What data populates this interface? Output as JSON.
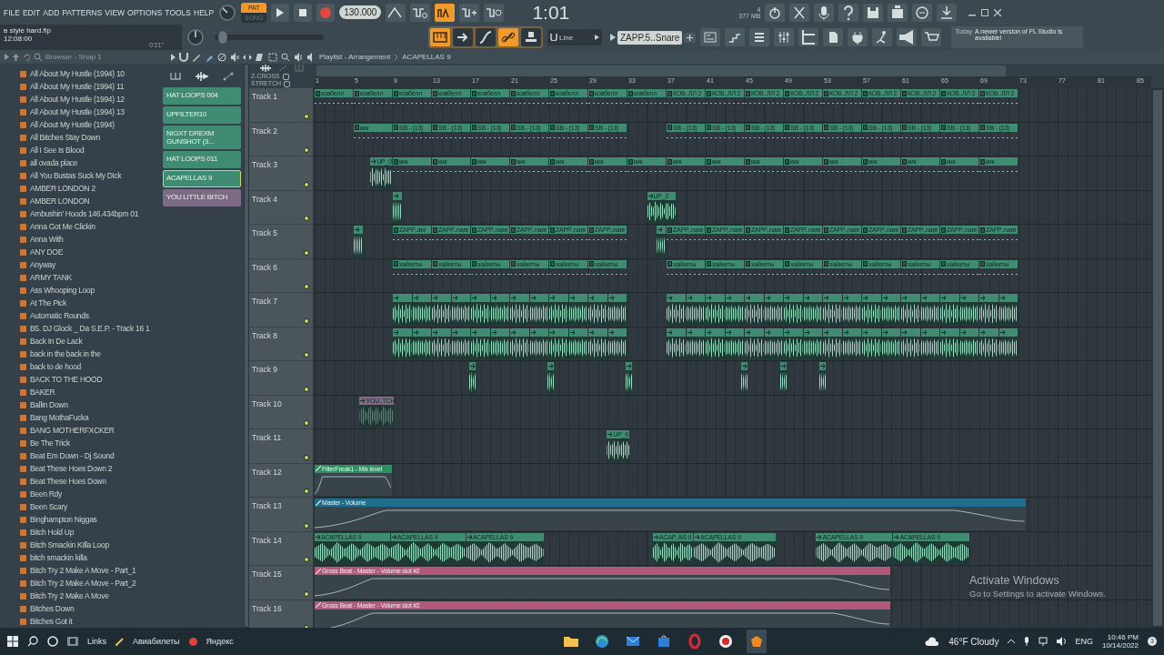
{
  "menu": [
    "FILE",
    "EDIT",
    "ADD",
    "PATTERNS",
    "VIEW",
    "OPTIONS",
    "TOOLS",
    "HELP"
  ],
  "project": {
    "file": "в style hard.flp",
    "time": "12:08:00",
    "duration": "0'21''"
  },
  "transport": {
    "modes": [
      {
        "label": "PAT",
        "selected": true
      },
      {
        "label": "SONG",
        "selected": false
      }
    ],
    "tempo": "130.000",
    "time": "1:01",
    "cpu": "4",
    "memory": "377 MB"
  },
  "toggles_top": [
    {
      "on": false
    },
    {
      "on": false
    },
    {
      "on": true
    },
    {
      "on": false
    },
    {
      "on": false
    }
  ],
  "master_pitch": {
    "level": 0.04
  },
  "toggles_bottom": [
    {
      "on": true
    },
    {
      "on": false
    },
    {
      "on": false
    },
    {
      "on": true
    },
    {
      "on": false
    }
  ],
  "snap": "Line",
  "pattern": "ZAPP.5..Snare",
  "news": {
    "day": "Today",
    "text": "A newer version of FL Studio is available!"
  },
  "browser": {
    "title": "Browser - Snap 1",
    "items": [
      "All About My Hustle (1994) 10",
      "All About My Hustle (1994) 11",
      "All About My Hustle (1994) 12",
      "All About My Hustle (1994) 13",
      "All About My Hustle (1994)",
      "All Bitches Stay Down",
      "All I See Is Blood",
      "all ovada place",
      "All You Bustas Suck My DIck",
      "AMBER LONDON 2",
      "AMBER LONDON",
      "Ambushin' Hoods 146.434bpm 01",
      "Anna Got Me Clickin",
      "Anna With",
      "ANY DOE",
      "Anyway",
      "ARMY TANK",
      "Ass Whooping Loop",
      "At The Pick",
      "Automatic Rounds",
      "B5. DJ Glock _ Da S.E.P. - Track 16 1",
      "Back In De Lack",
      "back in the back in the",
      "back to de hood",
      "BACK TO THE HOOD",
      "BAKER",
      "Ballin Down",
      "Bang MothaFucka",
      "BANG MOTHERFXCKER",
      "Be The Trick",
      "Beat Em Down - Dj Sound",
      "Beat These Hoes Down 2",
      "Beat These Hoes Down",
      "Been Rdy",
      "Been Scary",
      "Binghampton Niggas",
      "Bitch Hold Up",
      "Bitch Smackin KIlla Loop",
      "bitch smackin killa",
      "Bitch Try 2 Make A Move - Part_1",
      "Bitch Try 2 Make A Move - Part_2",
      "Bitch Try 2 Make A Move",
      "Bitches Down",
      "Bitches Got it"
    ]
  },
  "playlist": {
    "title": "Playlist - Arrangement",
    "pattern": "ACAPELLAS 9",
    "picker": [
      {
        "label": "HAT LOOPS 004",
        "color": "#3f8c73",
        "selected": false
      },
      {
        "label": "UPFILTER10",
        "color": "#3f8c73",
        "selected": false
      },
      {
        "label": "NIGXT DREXM GUNSHOT (3...",
        "color": "#3f8c73",
        "selected": false
      },
      {
        "label": "HAT LOOPS 011",
        "color": "#3f8c73",
        "selected": false
      },
      {
        "label": "ACAPELLAS 9",
        "color": "#3f8c73",
        "selected": true
      },
      {
        "label": "YOU LITTLE BITCH",
        "color": "#7d6b85",
        "selected": false
      }
    ],
    "options": [
      {
        "label": "Z-CROSS",
        "checked": false
      },
      {
        "label": "STRETCH",
        "checked": false
      }
    ],
    "ruler": [
      "1",
      "5",
      "9",
      "13",
      "17",
      "21",
      "25",
      "29",
      "33",
      "37",
      "41",
      "45",
      "49",
      "53",
      "57",
      "61",
      "65",
      "69",
      "73",
      "77",
      "81",
      "85"
    ],
    "tracks": [
      {
        "name": "Track 1",
        "enabled": true,
        "clips": [
          {
            "kind": "pattern",
            "label": "ковбелл"
          },
          {
            "kind": "pattern",
            "label": "ковбелл"
          },
          {
            "kind": "pattern",
            "label": "ковбелл"
          },
          {
            "kind": "pattern",
            "label": "ковбелл"
          },
          {
            "kind": "pattern",
            "label": "ковбелл"
          },
          {
            "kind": "pattern",
            "label": "ковбелл"
          },
          {
            "kind": "pattern",
            "label": "ковбелл"
          },
          {
            "kind": "pattern",
            "label": "ковбелл"
          },
          {
            "kind": "pattern",
            "label": "ковбелл"
          },
          {
            "kind": "pattern",
            "label": "КОВ..ЛЛ 2"
          },
          {
            "kind": "pattern",
            "label": "КОВ..ЛЛ 2"
          },
          {
            "kind": "pattern",
            "label": "КОВ..ЛЛ 2"
          },
          {
            "kind": "pattern",
            "label": "КОВ..ЛЛ 2"
          },
          {
            "kind": "pattern",
            "label": "КОВ..ЛЛ 2"
          },
          {
            "kind": "pattern",
            "label": "КОВ..ЛЛ 2"
          },
          {
            "kind": "pattern",
            "label": "КОВ..ЛЛ 2"
          },
          {
            "kind": "pattern",
            "label": "КОВ..ЛЛ 2"
          },
          {
            "kind": "pattern",
            "label": "КОВ..ЛЛ 2"
          }
        ]
      },
      {
        "name": "Track 2",
        "enabled": true,
        "clips": [
          {
            "kind": "pattern",
            "label": "кик"
          },
          {
            "kind": "pattern",
            "label": "SB - (13)"
          },
          {
            "kind": "pattern",
            "label": "SB - (13)"
          },
          {
            "kind": "pattern",
            "label": "SB - (13)"
          },
          {
            "kind": "pattern",
            "label": "SB - (13)"
          },
          {
            "kind": "pattern",
            "label": "SB - (13)"
          },
          {
            "kind": "pattern",
            "label": "SB - (13)"
          },
          {
            "kind": "pattern",
            "label": "SB - (13)"
          },
          {
            "kind": "pattern",
            "label": "SB - (13)"
          },
          {
            "kind": "pattern",
            "label": "SB - (13)"
          },
          {
            "kind": "pattern",
            "label": "SB - (13)"
          },
          {
            "kind": "pattern",
            "label": "SB - (13)"
          },
          {
            "kind": "pattern",
            "label": "SB - (13)"
          },
          {
            "kind": "pattern",
            "label": "SB - (13)"
          },
          {
            "kind": "pattern",
            "label": "SB - (13)"
          },
          {
            "kind": "pattern",
            "label": "SB - (13)"
          }
        ]
      },
      {
        "name": "Track 3",
        "enabled": true,
        "clips": [
          {
            "kind": "audio",
            "label": "UP_0"
          },
          {
            "kind": "pattern",
            "label": "кик"
          },
          {
            "kind": "pattern",
            "label": "кик"
          },
          {
            "kind": "pattern",
            "label": "кик"
          },
          {
            "kind": "pattern",
            "label": "кик"
          },
          {
            "kind": "pattern",
            "label": "кик"
          },
          {
            "kind": "pattern",
            "label": "кик"
          },
          {
            "kind": "pattern",
            "label": "кик"
          },
          {
            "kind": "pattern",
            "label": "кик"
          },
          {
            "kind": "pattern",
            "label": "кик"
          },
          {
            "kind": "pattern",
            "label": "кик"
          },
          {
            "kind": "pattern",
            "label": "кик"
          },
          {
            "kind": "pattern",
            "label": "кик"
          },
          {
            "kind": "pattern",
            "label": "кик"
          },
          {
            "kind": "pattern",
            "label": "кик"
          },
          {
            "kind": "pattern",
            "label": "кик"
          },
          {
            "kind": "pattern",
            "label": "кик"
          }
        ]
      },
      {
        "name": "Track 4",
        "enabled": true,
        "clips": [
          {
            "kind": "audio"
          },
          {
            "kind": "audio",
            "label": "UP_0"
          }
        ]
      },
      {
        "name": "Track 5",
        "enabled": true,
        "clips": [
          {
            "kind": "audio"
          },
          {
            "kind": "pattern",
            "label": "ZAPP..are"
          },
          {
            "kind": "pattern",
            "label": "ZAPP..nare"
          },
          {
            "kind": "pattern",
            "label": "ZAPP..nare"
          },
          {
            "kind": "pattern",
            "label": "ZAPP..nare"
          },
          {
            "kind": "pattern",
            "label": "ZAPP..nare"
          },
          {
            "kind": "pattern",
            "label": "ZAPP..nare"
          },
          {
            "kind": "audio"
          },
          {
            "kind": "pattern",
            "label": "ZAPP..nare"
          },
          {
            "kind": "pattern",
            "label": "ZAPP..nare"
          },
          {
            "kind": "pattern",
            "label": "ZAPP..nare"
          },
          {
            "kind": "pattern",
            "label": "ZAPP..nare"
          },
          {
            "kind": "pattern",
            "label": "ZAPP..nare"
          },
          {
            "kind": "pattern",
            "label": "ZAPP..nare"
          },
          {
            "kind": "pattern",
            "label": "ZAPP..nare"
          },
          {
            "kind": "pattern",
            "label": "ZAPP..nare"
          },
          {
            "kind": "pattern",
            "label": "ZAPP..nare"
          }
        ]
      },
      {
        "name": "Track 6",
        "enabled": true,
        "clips": [
          {
            "kind": "pattern",
            "label": "хайхеты"
          },
          {
            "kind": "pattern",
            "label": "хайхеты"
          },
          {
            "kind": "pattern",
            "label": "хайхеты"
          },
          {
            "kind": "pattern",
            "label": "хайхеты"
          },
          {
            "kind": "pattern",
            "label": "хайхеты"
          },
          {
            "kind": "pattern",
            "label": "хайхеты"
          },
          {
            "kind": "pattern",
            "label": "хайхеты"
          },
          {
            "kind": "pattern",
            "label": "хайхеты"
          },
          {
            "kind": "pattern",
            "label": "хайхеты"
          },
          {
            "kind": "pattern",
            "label": "хайхеты"
          },
          {
            "kind": "pattern",
            "label": "хайхеты"
          },
          {
            "kind": "pattern",
            "label": "хайхеты"
          },
          {
            "kind": "pattern",
            "label": "хайхеты"
          },
          {
            "kind": "pattern",
            "label": "хайхеты"
          },
          {
            "kind": "pattern",
            "label": "хайхеты"
          }
        ]
      },
      {
        "name": "Track 7",
        "enabled": true,
        "clips": [
          {
            "kind": "audio"
          },
          {
            "kind": "audio"
          },
          {
            "kind": "audio"
          },
          {
            "kind": "audio"
          },
          {
            "kind": "audio"
          },
          {
            "kind": "audio"
          },
          {
            "kind": "audio"
          },
          {
            "kind": "audio"
          },
          {
            "kind": "audio"
          },
          {
            "kind": "audio"
          },
          {
            "kind": "audio"
          },
          {
            "kind": "audio"
          },
          {
            "kind": "audio"
          },
          {
            "kind": "audio"
          },
          {
            "kind": "audio"
          },
          {
            "kind": "audio"
          },
          {
            "kind": "audio"
          },
          {
            "kind": "audio"
          },
          {
            "kind": "audio"
          },
          {
            "kind": "audio"
          },
          {
            "kind": "audio"
          },
          {
            "kind": "audio"
          },
          {
            "kind": "audio"
          },
          {
            "kind": "audio"
          },
          {
            "kind": "audio"
          },
          {
            "kind": "audio"
          },
          {
            "kind": "audio"
          },
          {
            "kind": "audio"
          },
          {
            "kind": "audio"
          },
          {
            "kind": "audio"
          }
        ]
      },
      {
        "name": "Track 8",
        "enabled": true,
        "clips": [
          {
            "kind": "audio"
          },
          {
            "kind": "audio"
          },
          {
            "kind": "audio"
          },
          {
            "kind": "audio"
          },
          {
            "kind": "audio"
          },
          {
            "kind": "audio"
          },
          {
            "kind": "audio"
          },
          {
            "kind": "audio"
          },
          {
            "kind": "audio"
          },
          {
            "kind": "audio"
          },
          {
            "kind": "audio"
          },
          {
            "kind": "audio"
          },
          {
            "kind": "audio"
          },
          {
            "kind": "audio"
          },
          {
            "kind": "audio"
          },
          {
            "kind": "audio"
          },
          {
            "kind": "audio"
          },
          {
            "kind": "audio"
          },
          {
            "kind": "audio"
          },
          {
            "kind": "audio"
          },
          {
            "kind": "audio"
          },
          {
            "kind": "audio"
          },
          {
            "kind": "audio"
          },
          {
            "kind": "audio"
          },
          {
            "kind": "audio"
          },
          {
            "kind": "audio"
          },
          {
            "kind": "audio"
          },
          {
            "kind": "audio"
          },
          {
            "kind": "audio"
          },
          {
            "kind": "audio"
          }
        ]
      },
      {
        "name": "Track 9",
        "enabled": true,
        "clips": [
          {
            "kind": "audio"
          },
          {
            "kind": "audio"
          },
          {
            "kind": "audio"
          },
          {
            "kind": "audio"
          },
          {
            "kind": "audio"
          },
          {
            "kind": "audio"
          }
        ]
      },
      {
        "name": "Track 10",
        "enabled": true,
        "clips": [
          {
            "kind": "audio",
            "label": "YOU..TCH",
            "color": "#7d6b85"
          }
        ]
      },
      {
        "name": "Track 11",
        "enabled": true,
        "clips": [
          {
            "kind": "audio",
            "label": "UP_0"
          }
        ]
      },
      {
        "name": "Track 12",
        "enabled": true,
        "clips": [
          {
            "kind": "automation",
            "label": "FilterFreak1 - Mix level",
            "color": "#2f8f62"
          }
        ]
      },
      {
        "name": "Track 13",
        "enabled": true,
        "clips": [
          {
            "kind": "automation",
            "label": "Master - Volume",
            "color": "#1f6e8e"
          }
        ]
      },
      {
        "name": "Track 14",
        "enabled": true,
        "clips": [
          {
            "kind": "audio",
            "label": "ACAPELLAS 9"
          },
          {
            "kind": "audio",
            "label": "ACAPELLAS 9"
          },
          {
            "kind": "audio",
            "label": "ACAPELLAS 9"
          },
          {
            "kind": "audio",
            "label": "ACAP..AS 9"
          },
          {
            "kind": "audio",
            "label": "ACAPELLAS 9"
          },
          {
            "kind": "audio",
            "label": "ACAPELLAS 9"
          },
          {
            "kind": "audio",
            "label": "ACAPELLAS 9"
          }
        ]
      },
      {
        "name": "Track 15",
        "enabled": true,
        "clips": [
          {
            "kind": "automation",
            "label": "Gross Beat - Master - Volume slot #2",
            "color": "#b05a78"
          }
        ]
      },
      {
        "name": "Track 16",
        "enabled": true,
        "clips": [
          {
            "kind": "automation",
            "label": "Gross Beat - Master - Volume slot #2",
            "color": "#b05a78"
          }
        ]
      }
    ]
  },
  "activation": {
    "title": "Activate Windows",
    "text": "Go to Settings to activate Windows."
  },
  "taskbar": {
    "links": "Links",
    "bookmarks": [
      "Авиабилеты",
      "Яндекс"
    ],
    "apps": [
      {
        "kind": "folder",
        "active": false
      },
      {
        "kind": "browser",
        "active": false
      },
      {
        "kind": "mail",
        "active": false
      },
      {
        "kind": "store",
        "active": false
      },
      {
        "kind": "ring",
        "active": false
      },
      {
        "kind": "record",
        "active": false
      },
      {
        "kind": "fruit",
        "active": true
      }
    ],
    "weather": "46°F Cloudy",
    "language": "ENG",
    "time": "10:46 PM",
    "date": "10/14/2022",
    "notifications": "3"
  }
}
